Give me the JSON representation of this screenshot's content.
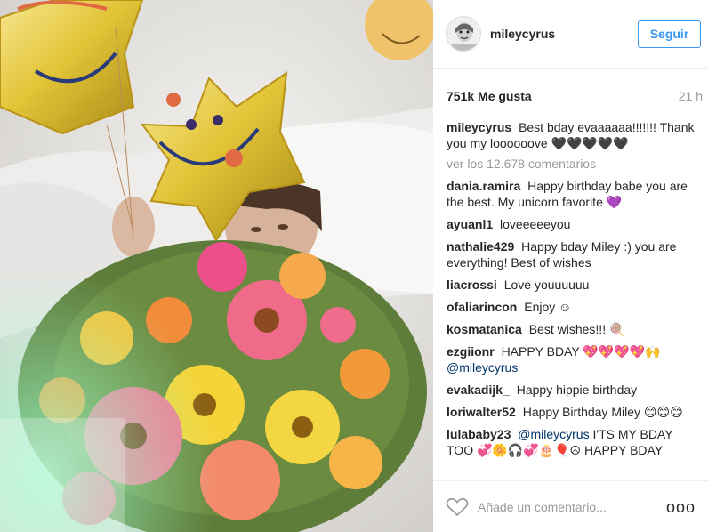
{
  "post": {
    "username": "mileycyrus",
    "follow_label": "Seguir",
    "likes": "751k Me gusta",
    "time": "21 h",
    "caption_user": "mileycyrus",
    "caption_text": "Best bday evaaaaaa!!!!!!! Thank you my loooooove 🖤🖤🖤🖤🖤",
    "view_all": "ver los 12.678 comentarios"
  },
  "comments": [
    {
      "user": "dania.ramira",
      "text": "Happy birthday babe you are the best. My unicorn favorite 💜"
    },
    {
      "user": "ayuanl1",
      "text": "loveeeeeyou"
    },
    {
      "user": "nathalie429",
      "text": "Happy bday Miley :) you are everything! Best of wishes"
    },
    {
      "user": "liacrossi",
      "text": "Love youuuuuu"
    },
    {
      "user": "ofaliarincon",
      "text": "Enjoy ☺"
    },
    {
      "user": "kosmatanica",
      "text": "Best wishes!!! 🍭"
    },
    {
      "user": "ezgiionr",
      "text": "HAPPY BDAY 💖💖💖💖🙌",
      "mention": "@mileycyrus"
    },
    {
      "user": "evakadijk_",
      "text": "Happy hippie birthday"
    },
    {
      "user": "loriwalter52",
      "text": "Happy Birthday Miley 😊😊😊"
    },
    {
      "user": "lulababy23",
      "mention": "@mileycyrus",
      "text": "I'TS MY BDAY TOO 💞🌼🎧💞🎂🎈☮ HAPPY BDAY"
    }
  ],
  "footer": {
    "placeholder": "Añade un comentario...",
    "more": "ooo",
    "heart_icon": "heart-outline-icon"
  },
  "icons": {
    "avatar": "avatar-icon",
    "like": "heart-outline-icon",
    "options": "more-options-icon"
  },
  "colors": {
    "accent": "#3897f0",
    "text": "#262626",
    "muted": "#999999",
    "mention": "#003569"
  }
}
